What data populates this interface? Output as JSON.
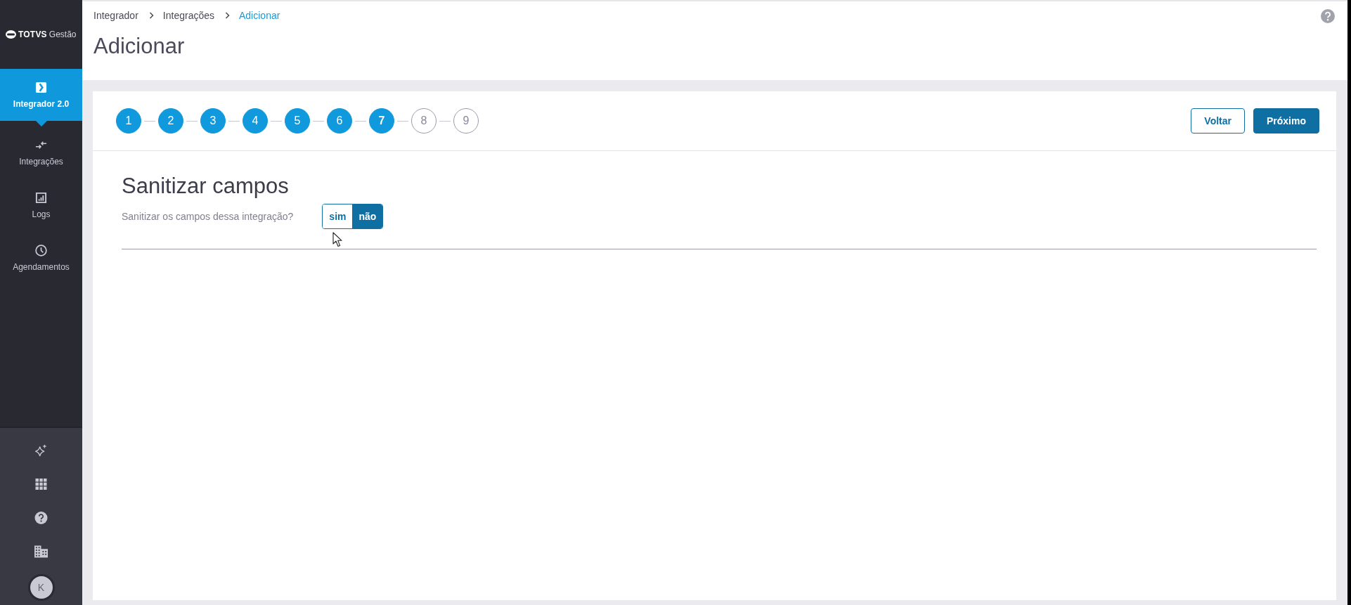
{
  "sidebar": {
    "logo": {
      "brand": "TOTVS",
      "product": "Gestão"
    },
    "items": [
      {
        "label": "Integrador 2.0",
        "selected": true
      },
      {
        "label": "Integrações",
        "selected": false
      },
      {
        "label": "Logs",
        "selected": false
      },
      {
        "label": "Agendamentos",
        "selected": false
      }
    ],
    "avatar": {
      "initial": "K"
    }
  },
  "breadcrumb": [
    {
      "label": "Integrador",
      "current": false
    },
    {
      "label": "Integrações",
      "current": false
    },
    {
      "label": "Adicionar",
      "current": true
    }
  ],
  "page_title": "Adicionar",
  "stepper": {
    "steps": [
      {
        "label": "1",
        "done": true,
        "selected": false
      },
      {
        "label": "2",
        "done": true,
        "selected": false
      },
      {
        "label": "3",
        "done": true,
        "selected": false
      },
      {
        "label": "4",
        "done": true,
        "selected": false
      },
      {
        "label": "5",
        "done": true,
        "selected": false
      },
      {
        "label": "6",
        "done": true,
        "selected": false
      },
      {
        "label": "7",
        "done": false,
        "selected": true
      },
      {
        "label": "8",
        "done": false,
        "selected": false
      },
      {
        "label": "9",
        "done": false,
        "selected": false
      }
    ]
  },
  "actions": [
    {
      "label": "Voltar",
      "kind": "outline"
    },
    {
      "label": "Próximo",
      "kind": "primary"
    }
  ],
  "section": {
    "title": "Sanitizar campos",
    "question": "Sanitizar os campos dessa integração?",
    "options": [
      {
        "label": "sim",
        "selected": false
      },
      {
        "label": "não",
        "selected": true
      }
    ]
  }
}
